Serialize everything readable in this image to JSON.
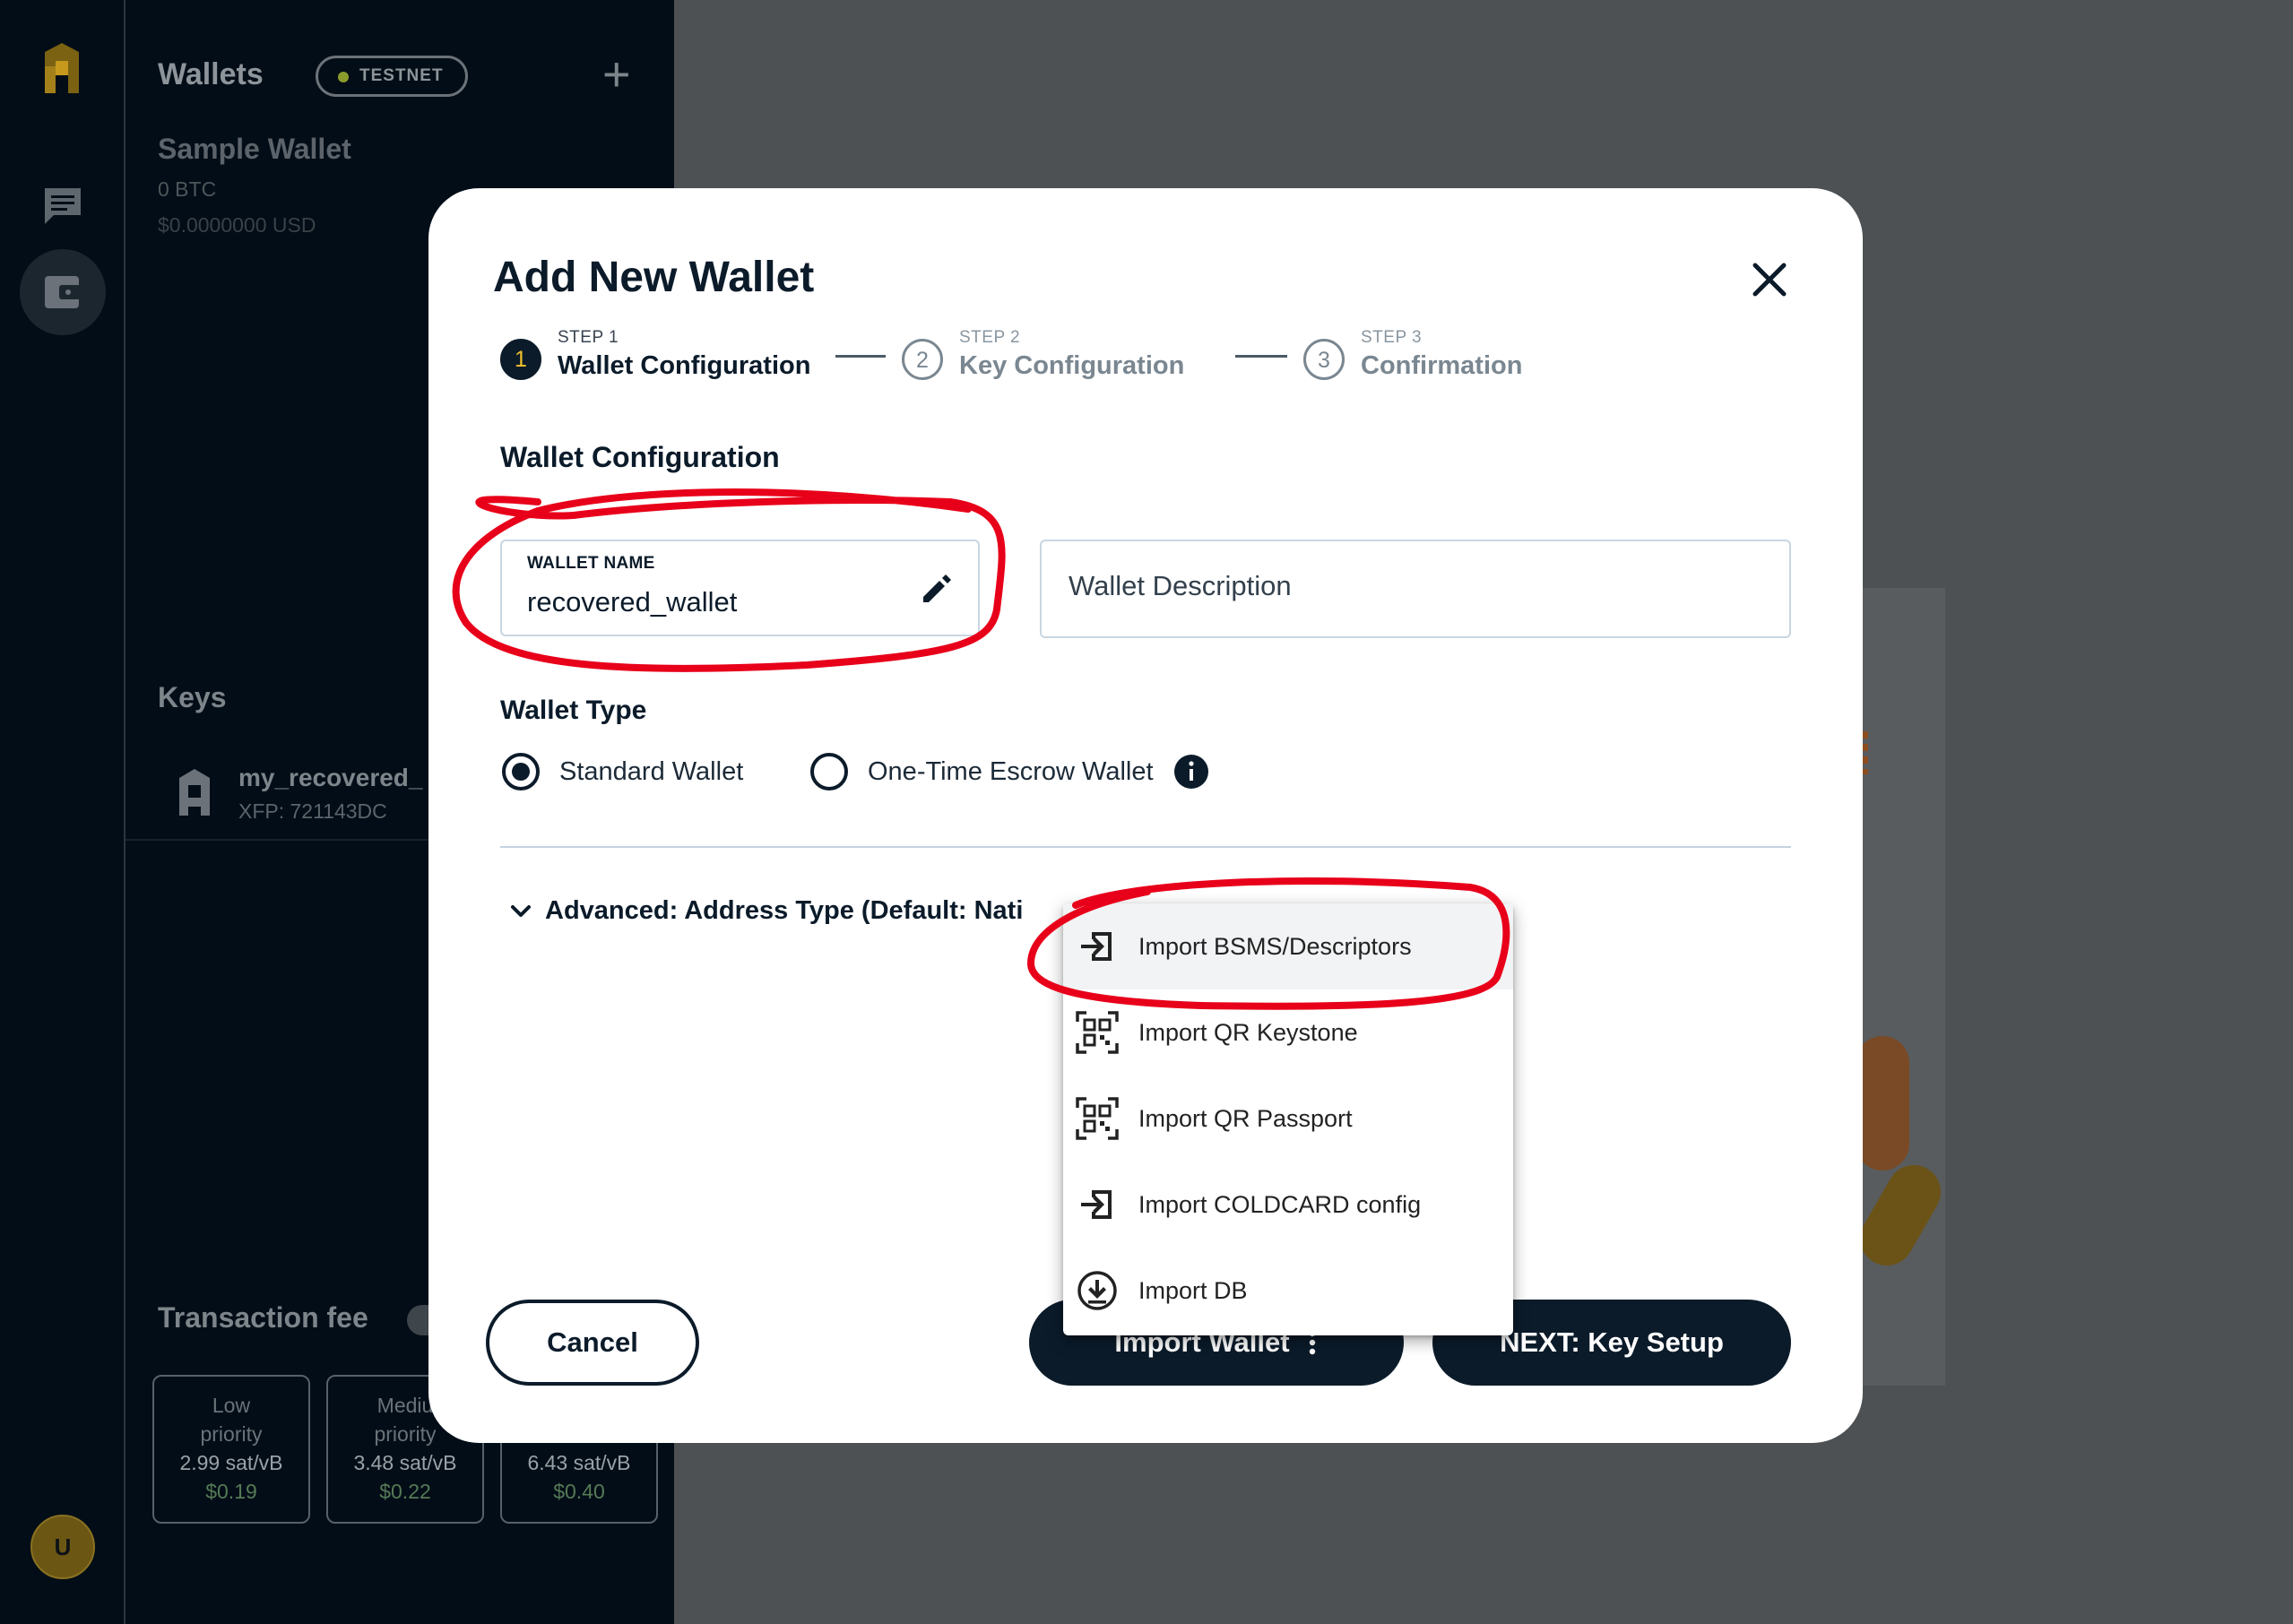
{
  "sidebar": {
    "wallets_title": "Wallets",
    "network_badge": "TESTNET",
    "add_label": "+",
    "wallet": {
      "name": "Sample Wallet",
      "btc": "0 BTC",
      "usd": "$0.0000000 USD"
    },
    "keys_title": "Keys",
    "key": {
      "name": "my_recovered_",
      "xfp": "XFP: 721143DC"
    },
    "fee_title": "Transaction fee",
    "fees": [
      {
        "line1": "Low",
        "line2": "priority",
        "sat": "2.99 sat/vB",
        "usd": "$0.19"
      },
      {
        "line1": "Mediu",
        "line2": "priority",
        "sat": "3.48 sat/vB",
        "usd": "$0.22"
      },
      {
        "line1": "",
        "line2": "",
        "sat": "6.43 sat/vB",
        "usd": "$0.40"
      }
    ],
    "avatar_initial": "U"
  },
  "modal": {
    "title": "Add New Wallet",
    "steps": [
      {
        "num_circle": "1",
        "num": "STEP 1",
        "label": "Wallet Configuration",
        "state": "active"
      },
      {
        "num_circle": "2",
        "num": "STEP 2",
        "label": "Key Configuration",
        "state": "inactive"
      },
      {
        "num_circle": "3",
        "num": "STEP 3",
        "label": "Confirmation",
        "state": "inactive"
      }
    ],
    "section_title": "Wallet Configuration",
    "wallet_name": {
      "label": "WALLET NAME",
      "value": "recovered_wallet"
    },
    "wallet_description": {
      "placeholder": "Wallet Description"
    },
    "wallet_type_title": "Wallet Type",
    "wallet_types": [
      {
        "label": "Standard Wallet",
        "selected": true
      },
      {
        "label": "One-Time Escrow Wallet",
        "selected": false
      }
    ],
    "advanced_label": "Advanced: Address Type (Default: Nati",
    "buttons": {
      "cancel": "Cancel",
      "import": "Import Wallet",
      "next": "NEXT: Key Setup"
    }
  },
  "import_menu": {
    "items": [
      {
        "label": "Import BSMS/Descriptors",
        "icon": "import-icon",
        "highlighted": true
      },
      {
        "label": "Import QR Keystone",
        "icon": "qr-scan-icon",
        "highlighted": false
      },
      {
        "label": "Import QR Passport",
        "icon": "qr-scan-icon",
        "highlighted": false
      },
      {
        "label": "Import COLDCARD config",
        "icon": "import-icon",
        "highlighted": false
      },
      {
        "label": "Import DB",
        "icon": "download-circle-icon",
        "highlighted": false
      }
    ]
  },
  "colors": {
    "primary_dark": "#0b1b2a",
    "accent_yellow": "#f3c12b",
    "annotation_red": "#e8001a"
  }
}
